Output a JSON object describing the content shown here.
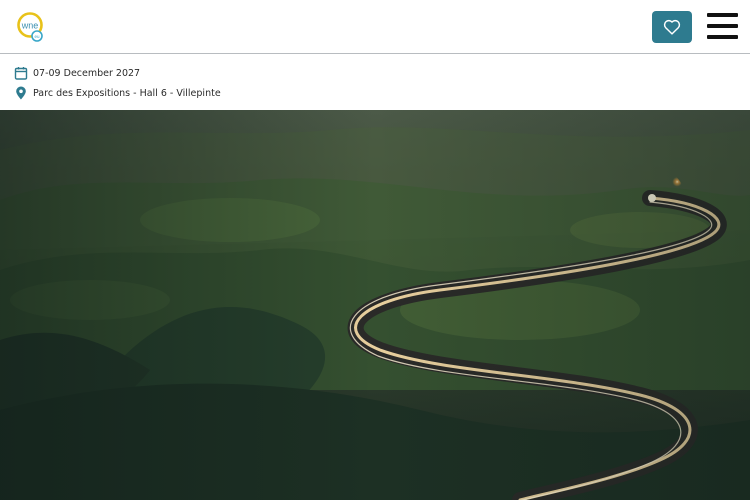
{
  "header": {
    "logo": {
      "text": "wne",
      "subtext": "eu",
      "colors": [
        "#e8c21a",
        "#3aa7c9"
      ]
    },
    "favorites_icon": "heart-icon",
    "menu_icon": "hamburger-menu-icon",
    "accent": "#2e7b8f"
  },
  "event": {
    "dates": "07-09 December 2027",
    "location": "Parc des Expositions - Hall 6 - Villepinte",
    "date_icon": "calendar-icon",
    "location_icon": "map-pin-icon",
    "icon_color": "#2e7b8f"
  },
  "hero": {
    "image": "night-winding-road-through-green-hills"
  }
}
